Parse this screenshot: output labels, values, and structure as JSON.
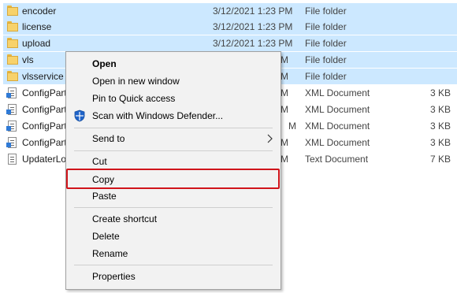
{
  "files": [
    {
      "name": "encoder",
      "date": "3/12/2021 1:23 PM",
      "type": "File folder",
      "size": "",
      "icon": "folder-icon",
      "selected": true
    },
    {
      "name": "license",
      "date": "3/12/2021 1:23 PM",
      "type": "File folder",
      "size": "",
      "icon": "folder-icon",
      "selected": true
    },
    {
      "name": "upload",
      "date": "3/12/2021 1:23 PM",
      "type": "File folder",
      "size": "",
      "icon": "folder-icon",
      "selected": true
    },
    {
      "name": "vls",
      "date": "M",
      "type": "File folder",
      "size": "",
      "icon": "folder-icon",
      "selected": true
    },
    {
      "name": "vlsservice",
      "date": "M",
      "type": "File folder",
      "size": "",
      "icon": "folder-icon",
      "selected": true
    },
    {
      "name": "ConfigPart",
      "date": "M",
      "type": "XML Document",
      "size": "3 KB",
      "icon": "xml-document-icon",
      "selected": false
    },
    {
      "name": "ConfigPart",
      "date": "M",
      "type": "XML Document",
      "size": "3 KB",
      "icon": "xml-document-icon",
      "selected": false
    },
    {
      "name": "ConfigPart",
      "date": "M",
      "type": "XML Document",
      "size": "3 KB",
      "icon": "xml-document-icon",
      "selected": false
    },
    {
      "name": "ConfigPart",
      "date": "M",
      "type": "XML Document",
      "size": "3 KB",
      "icon": "xml-document-icon",
      "selected": false
    },
    {
      "name": "UpdaterLo",
      "date": "M",
      "type": "Text Document",
      "size": "7 KB",
      "icon": "text-document-icon",
      "selected": false
    }
  ],
  "menu": {
    "open": "Open",
    "open_new_window": "Open in new window",
    "pin_quick_access": "Pin to Quick access",
    "scan_defender": "Scan with Windows Defender...",
    "send_to": "Send to",
    "cut": "Cut",
    "copy": "Copy",
    "paste": "Paste",
    "create_shortcut": "Create shortcut",
    "delete": "Delete",
    "rename": "Rename",
    "properties": "Properties"
  },
  "colors": {
    "selection": "#cce8ff",
    "highlight_border": "#d0141b",
    "menu_bg": "#f2f2f2"
  }
}
